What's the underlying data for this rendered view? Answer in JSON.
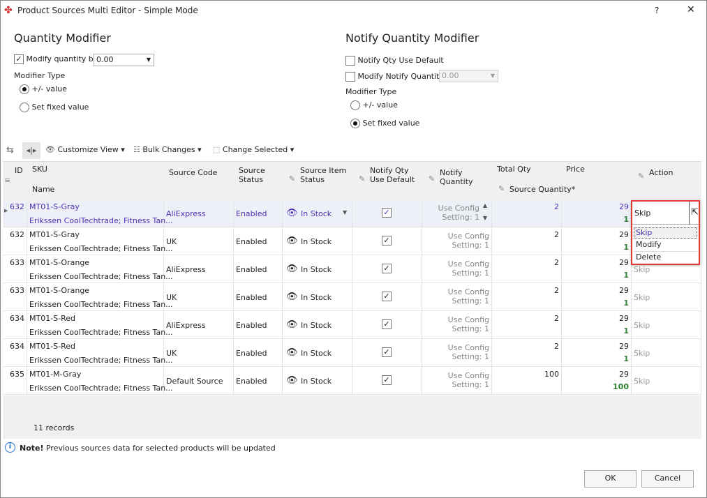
{
  "window": {
    "title": "Product Sources Multi Editor - Simple Mode",
    "help": "?",
    "close": "✕"
  },
  "qty": {
    "title": "Quantity Modifier",
    "modify_label": "Modify quantity by",
    "modify_checked": true,
    "value": "0.00",
    "type_label": "Modifier Type",
    "opt1": "+/- value",
    "opt2": "Set fixed value",
    "selected": "+/- value"
  },
  "notify": {
    "title": "Notify Quantity Modifier",
    "use_default": "Notify Qty Use Default",
    "modify_label": "Modify Notify Quantity",
    "value": "0.00",
    "type_label": "Modifier Type",
    "opt1": "+/- value",
    "opt2": "Set fixed value",
    "selected": "Set fixed value"
  },
  "toolbar": {
    "customize": "Customize View",
    "bulk": "Bulk Changes",
    "change_selected": "Change Selected"
  },
  "columns": {
    "id": "ID",
    "sku": "SKU",
    "name": "Name",
    "source_code": "Source Code",
    "source_status": "Source Status",
    "item_status": "Source Item Status",
    "notify_default": "Notify Qty Use Default",
    "notify_qty": "Notify Quantity",
    "total_qty": "Total Qty",
    "price": "Price",
    "source_qty": "Source Quantity*",
    "action": "Action"
  },
  "rows": [
    {
      "id": "632",
      "sku": "MT01-S-Gray",
      "name": "Erikssen CoolTechtrade; Fitness Tan...",
      "source": "AliExpress",
      "status": "Enabled",
      "stock": "In Stock",
      "notify": "Use Config Setting: 1",
      "total": "2",
      "price": "29",
      "srcqty": "1",
      "action": "Skip"
    },
    {
      "id": "632",
      "sku": "MT01-S-Gray",
      "name": "Erikssen CoolTechtrade; Fitness Tan...",
      "source": "UK",
      "status": "Enabled",
      "stock": "In Stock",
      "notify": "Use Config Setting: 1",
      "total": "2",
      "price": "29",
      "srcqty": "1",
      "action": "Skip"
    },
    {
      "id": "633",
      "sku": "MT01-S-Orange",
      "name": "Erikssen CoolTechtrade; Fitness Tan...",
      "source": "AliExpress",
      "status": "Enabled",
      "stock": "In Stock",
      "notify": "Use Config Setting: 1",
      "total": "2",
      "price": "29",
      "srcqty": "1",
      "action": "Skip"
    },
    {
      "id": "633",
      "sku": "MT01-S-Orange",
      "name": "Erikssen CoolTechtrade; Fitness Tan...",
      "source": "UK",
      "status": "Enabled",
      "stock": "In Stock",
      "notify": "Use Config Setting: 1",
      "total": "2",
      "price": "29",
      "srcqty": "1",
      "action": "Skip"
    },
    {
      "id": "634",
      "sku": "MT01-S-Red",
      "name": "Erikssen CoolTechtrade; Fitness Tan...",
      "source": "AliExpress",
      "status": "Enabled",
      "stock": "In Stock",
      "notify": "Use Config Setting: 1",
      "total": "2",
      "price": "29",
      "srcqty": "1",
      "action": "Skip"
    },
    {
      "id": "634",
      "sku": "MT01-S-Red",
      "name": "Erikssen CoolTechtrade; Fitness Tan...",
      "source": "UK",
      "status": "Enabled",
      "stock": "In Stock",
      "notify": "Use Config Setting: 1",
      "total": "2",
      "price": "29",
      "srcqty": "1",
      "action": "Skip"
    },
    {
      "id": "635",
      "sku": "MT01-M-Gray",
      "name": "Erikssen CoolTechtrade; Fitness Tan...",
      "source": "Default Source",
      "status": "Enabled",
      "stock": "In Stock",
      "notify": "Use Config Setting: 1",
      "total": "100",
      "price": "29",
      "srcqty": "100",
      "action": "Skip"
    }
  ],
  "dropdown": {
    "options": [
      "Skip",
      "Modify",
      "Delete"
    ],
    "highlight": "#e53935"
  },
  "footer": {
    "records": "11 records"
  },
  "note": {
    "bold": "Note!",
    "text": " Previous sources data for selected products will be updated"
  },
  "buttons": {
    "ok": "OK",
    "cancel": "Cancel"
  }
}
